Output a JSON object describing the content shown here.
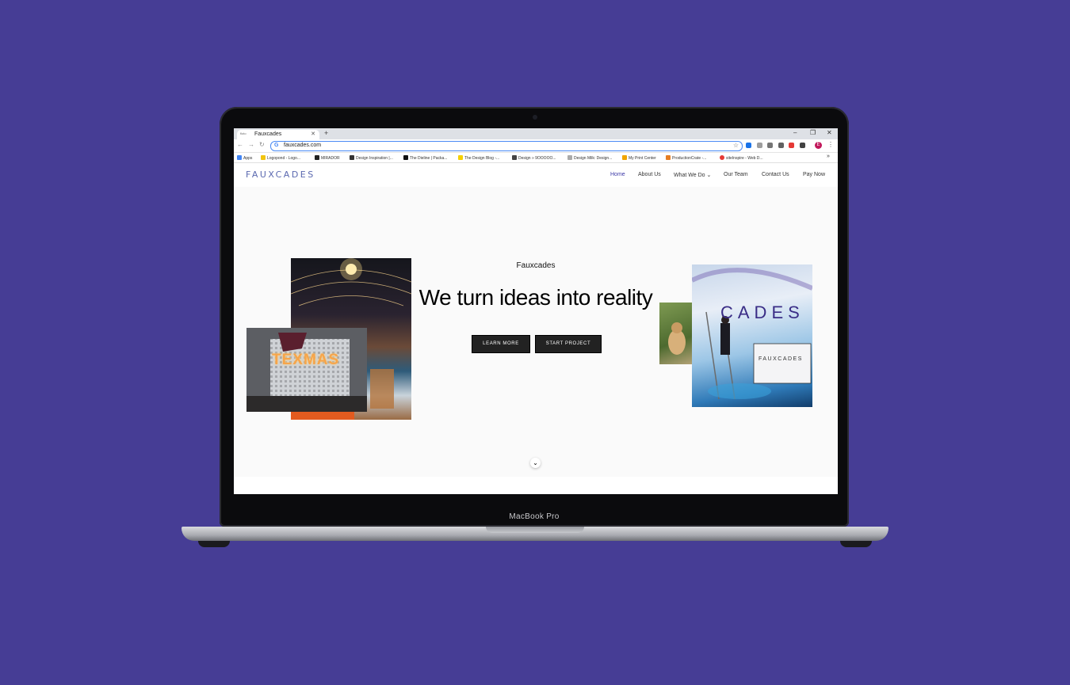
{
  "device": {
    "brand_label": "MacBook Pro"
  },
  "browser": {
    "tab_title": "Fauxcades",
    "tab_favicon_text": "floto",
    "address": "fauxcades.com",
    "profile_initial": "E",
    "bookmarks": [
      {
        "label": "Apps",
        "color": "#4285f4"
      },
      {
        "label": "Logopond - Logo...",
        "color": "#f1c40f"
      },
      {
        "label": "MIRADOR",
        "color": "#222222"
      },
      {
        "label": "Design Inspiration |...",
        "color": "#333333"
      },
      {
        "label": "The Dieline | Packa...",
        "color": "#111111"
      },
      {
        "label": "The Design Blog -...",
        "color": "#f5d000"
      },
      {
        "label": "Design » 9OOOOO...",
        "color": "#444444"
      },
      {
        "label": "Design Milk: Design...",
        "color": "#aaaaaa"
      },
      {
        "label": "My Print Center",
        "color": "#f0a500"
      },
      {
        "label": "ProductionCrate -...",
        "color": "#e67e22"
      },
      {
        "label": "siteInspire - Web D...",
        "color": "#e53935"
      }
    ]
  },
  "site": {
    "logo": "FAUXCADES",
    "nav": [
      {
        "label": "Home",
        "active": true
      },
      {
        "label": "About Us",
        "active": false
      },
      {
        "label": "What We Do ⌄",
        "active": false
      },
      {
        "label": "Our Team",
        "active": false
      },
      {
        "label": "Contact Us",
        "active": false
      },
      {
        "label": "Pay Now",
        "active": false
      }
    ],
    "hero": {
      "eyebrow": "Fauxcades",
      "headline": "We turn ideas into reality",
      "learn_more": "LEARN MORE",
      "start_project": "START PROJECT"
    },
    "image_texts": {
      "marquee": "TEXMAS",
      "wall_sign": "FAUXCADES",
      "mural": "CADES"
    }
  },
  "colors": {
    "background": "#463d95",
    "accent": "#3d3aa8",
    "logo": "#5b69b0"
  }
}
